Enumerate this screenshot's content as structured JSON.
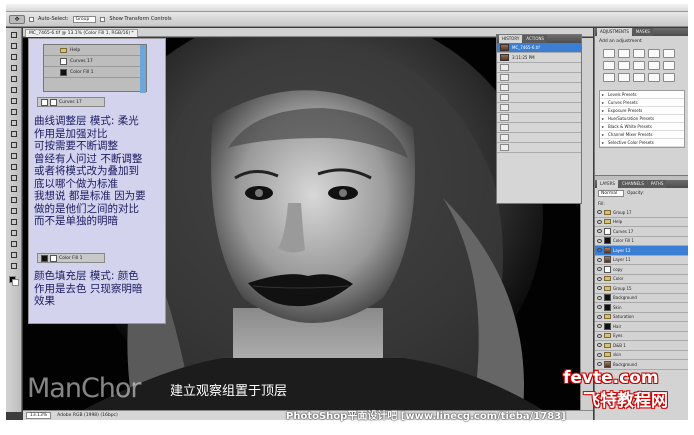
{
  "options_bar": {
    "auto_select_label": "Auto-Select:",
    "auto_select_value": "Group",
    "show_transform_label": "Show Transform Controls"
  },
  "document": {
    "tab_title": "MC_7465-6.tif @ 13.1% (Color Fill 1, RGB/16) *",
    "zoom": "13.13%",
    "status": "Adobe RGB (1998) (16bpc)"
  },
  "history_panel": {
    "tabs": [
      "HISTORY",
      "ACTIONS"
    ],
    "rows": [
      "MC_7465-6.tif",
      "3:11:25 PM",
      "",
      "",
      "",
      "",
      "",
      "",
      "",
      "",
      ""
    ]
  },
  "adjustments_panel": {
    "tabs": [
      "ADJUSTMENTS",
      "MASKS"
    ],
    "hint": "Add an adjustment",
    "presets": [
      "Levels Presets",
      "Curves Presets",
      "Exposure Presets",
      "Hue/Saturation Presets",
      "Black & White Presets",
      "Channel Mixer Presets",
      "Selective Color Presets"
    ]
  },
  "layers_panel": {
    "tabs": [
      "LAYERS",
      "CHANNELS",
      "PATHS"
    ],
    "blend_mode": "Normal",
    "opacity_label": "Opacity:",
    "fill_label": "Fill:",
    "layers": [
      {
        "name": "Group 17",
        "kind": "group"
      },
      {
        "name": "Help",
        "kind": "group"
      },
      {
        "name": "Curves 17",
        "kind": "adj"
      },
      {
        "name": "Color Fill 1",
        "kind": "fill"
      },
      {
        "name": "Layer 12",
        "kind": "photo"
      },
      {
        "name": "Layer 11",
        "kind": "photo"
      },
      {
        "name": "copy",
        "kind": "layer"
      },
      {
        "name": "Color",
        "kind": "group"
      },
      {
        "name": "Group 15",
        "kind": "group"
      },
      {
        "name": "Background",
        "kind": "mask"
      },
      {
        "name": "Skin",
        "kind": "mask"
      },
      {
        "name": "Saturation",
        "kind": "group"
      },
      {
        "name": "Hair",
        "kind": "mask"
      },
      {
        "name": "Eyes",
        "kind": "group"
      },
      {
        "name": "D&B 1",
        "kind": "group"
      },
      {
        "name": "skin",
        "kind": "group"
      },
      {
        "name": "Background",
        "kind": "photo"
      }
    ]
  },
  "overlay": {
    "mini_layers": [
      "Help",
      "Curves 17",
      "Color Fill 1"
    ],
    "chip1": "Curves 17",
    "chip2": "Color Fill 1",
    "text1": [
      "曲线调整层 模式: 柔光",
      "作用是加强对比",
      "可按需要不断调整",
      "曾经有人问过 不断调整",
      "或者将模式改为叠加到",
      "底以哪个做为标准",
      "我想说 都是标准 因为要",
      "做的是他们之间的对比",
      "而不是单独的明暗"
    ],
    "text2": [
      "颜色填充层 模式: 颜色",
      "作用是去色 只现察明暗",
      "效果"
    ]
  },
  "video": {
    "brand": "ManChor",
    "subtitle": "建立观察组置于顶层",
    "footer": "PhotoShop平面设计吧 [www.linecg.com/tieba/1783]"
  },
  "watermark": {
    "line1": "fevte.com",
    "line2": "飞特教程网"
  }
}
